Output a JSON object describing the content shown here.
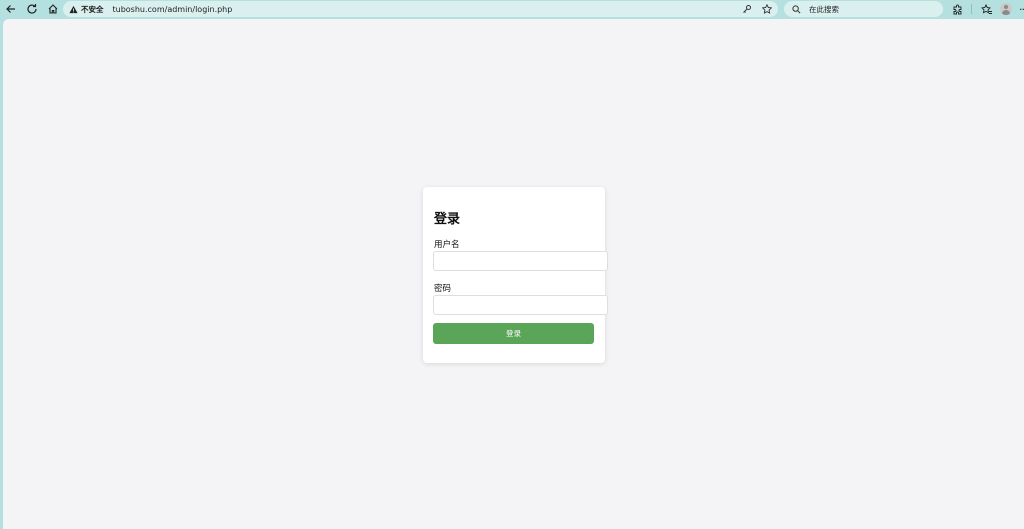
{
  "browser": {
    "security_label": "不安全",
    "url": "tuboshu.com/admin/login.php",
    "search_placeholder": "在此搜索"
  },
  "login": {
    "title": "登录",
    "username_label": "用户名",
    "username_value": "",
    "password_label": "密码",
    "password_value": "",
    "submit_label": "登录"
  },
  "colors": {
    "chrome": "#b4e1e0",
    "page_bg": "#f4f4f6",
    "button": "#5ba559"
  }
}
